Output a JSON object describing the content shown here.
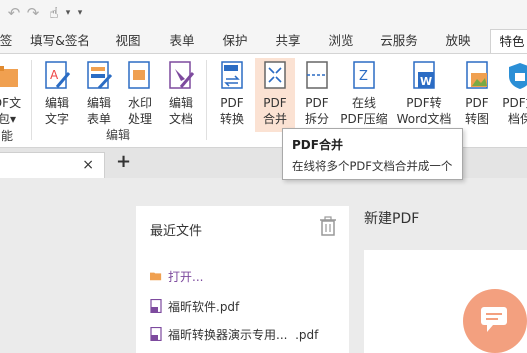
{
  "tabs": [
    {
      "label": "签"
    },
    {
      "label": "填写&签名"
    },
    {
      "label": "视图"
    },
    {
      "label": "表单"
    },
    {
      "label": "保护"
    },
    {
      "label": "共享"
    },
    {
      "label": "浏览"
    },
    {
      "label": "云服务"
    },
    {
      "label": "放映"
    },
    {
      "label": "特色"
    }
  ],
  "ribbon": {
    "left_partial": {
      "line1": "DF文",
      "line2": "包▾",
      "line3": "能"
    },
    "buttons": [
      {
        "line1": "编辑",
        "line2": "文字"
      },
      {
        "line1": "编辑",
        "line2": "表单"
      },
      {
        "line1": "水印",
        "line2": "处理"
      },
      {
        "line1": "编辑",
        "line2": "文档"
      },
      {
        "line1": "PDF",
        "line2": "转换"
      },
      {
        "line1": "PDF",
        "line2": "合并"
      },
      {
        "line1": "PDF",
        "line2": "拆分"
      },
      {
        "line1": "在线",
        "line2": "PDF压缩"
      },
      {
        "line1": "PDF转",
        "line2": "Word文档"
      },
      {
        "line1": "PDF",
        "line2": "转图"
      },
      {
        "line1": "PDF文",
        "line2": "档保"
      }
    ],
    "group_label": "编辑"
  },
  "tooltip": {
    "title": "PDF合并",
    "desc": "在线将多个PDF文档合并成一个"
  },
  "doc_tabs": {
    "close": "×",
    "new": "+"
  },
  "recent": {
    "title": "最近文件",
    "open_label": "打开...",
    "files": [
      {
        "name": "福昕软件.pdf"
      },
      {
        "name": "福昕转换器演示专用...  .pdf"
      }
    ]
  },
  "new_pdf": {
    "title": "新建PDF"
  },
  "colors": {
    "accent": "#f3a07f",
    "folder": "#f0a050",
    "pdf_icon": "#7d4a9e",
    "blue": "#2b6cc4"
  }
}
